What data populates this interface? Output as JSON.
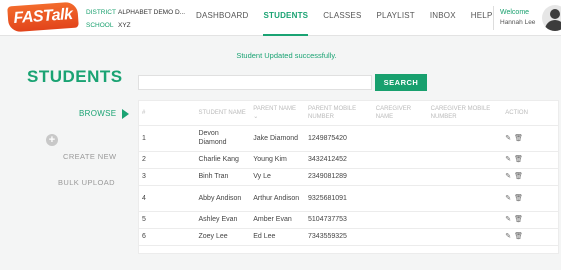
{
  "header": {
    "logo_text": "FASTalk",
    "district_label": "DISTRICT",
    "district_value": "ALPHABET DEMO D...",
    "school_label": "SCHOOL",
    "school_value": "XYZ",
    "nav": [
      "DASHBOARD",
      "STUDENTS",
      "CLASSES",
      "PLAYLIST",
      "INBOX",
      "HELP"
    ],
    "active_nav": "STUDENTS",
    "welcome": "Welcome",
    "user_name": "Hannah Lee"
  },
  "success_message": "Student Updated successfully.",
  "page_title": "STUDENTS",
  "search": {
    "placeholder": "",
    "value": "",
    "button_label": "SEARCH"
  },
  "side_menu": {
    "browse": "BROWSE",
    "create_new": "CREATE NEW",
    "bulk_upload": "BULK UPLOAD"
  },
  "table": {
    "headers": [
      "#",
      "STUDENT NAME",
      "PARENT NAME ⌄",
      "PARENT MOBILE NUMBER",
      "CAREGIVER NAME",
      "CAREGIVER MOBILE NUMBER",
      "ACTION"
    ],
    "rows": [
      {
        "num": "1",
        "student": "Devon Diamond",
        "parent": "Jake Diamond",
        "mobile": "1249875420",
        "caregiver": "",
        "caregiver_mobile": ""
      },
      {
        "num": "2",
        "student": "Charlie Kang",
        "parent": "Young Kim",
        "mobile": "3432412452",
        "caregiver": "",
        "caregiver_mobile": ""
      },
      {
        "num": "3",
        "student": "Binh Tran",
        "parent": "Vy Le",
        "mobile": "2349081289",
        "caregiver": "",
        "caregiver_mobile": ""
      },
      {
        "num": "4",
        "student": "Abby Andison",
        "parent": "Arthur Andison",
        "mobile": "9325681091",
        "caregiver": "",
        "caregiver_mobile": ""
      },
      {
        "num": "5",
        "student": "Ashley Evan",
        "parent": "Amber Evan",
        "mobile": "5104737753",
        "caregiver": "",
        "caregiver_mobile": ""
      },
      {
        "num": "6",
        "student": "Zoey Lee",
        "parent": "Ed Lee",
        "mobile": "7343559325",
        "caregiver": "",
        "caregiver_mobile": ""
      }
    ],
    "action_icons": [
      "edit-icon",
      "trash-icon"
    ]
  },
  "colors": {
    "accent": "#1aa373",
    "logo": "#e2441b"
  }
}
